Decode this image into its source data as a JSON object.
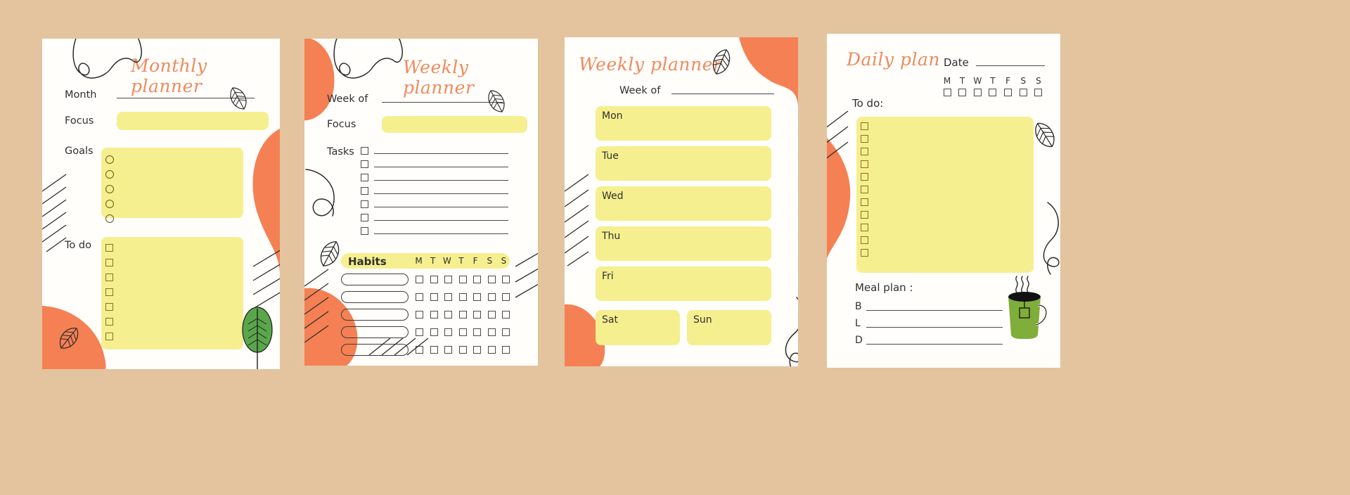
{
  "page": {
    "background_color": "#e3c49e",
    "card_color": "#fffefb",
    "accent_color": "#ef8a5d",
    "highlight_color": "#f5ef8f",
    "ink_color": "#2f2f2f",
    "leaf_color": "#5aa64b",
    "mug_color": "#7fae3a"
  },
  "cards": [
    {
      "id": "monthly-planner",
      "title": "Monthly planner",
      "fields": [
        {
          "label": "Month",
          "type": "rule"
        },
        {
          "label": "Focus",
          "type": "highlight-bar"
        }
      ],
      "goals": {
        "label": "Goals",
        "marker": "circle",
        "rows": 5
      },
      "todo": {
        "label": "To do",
        "marker": "square",
        "rows": 7
      }
    },
    {
      "id": "weekly-planner-tasks",
      "title": "Weekly planner",
      "fields": [
        {
          "label": "Week of",
          "type": "rule"
        },
        {
          "label": "Focus",
          "type": "highlight-bar"
        }
      ],
      "tasks": {
        "label": "Tasks",
        "marker": "square",
        "rows": 7
      },
      "habits": {
        "label": "Habits",
        "days": [
          "M",
          "T",
          "W",
          "T",
          "F",
          "S",
          "S"
        ],
        "rows": 5
      }
    },
    {
      "id": "weekly-planner-days",
      "title": "Weekly planner",
      "fields": [
        {
          "label": "Week of",
          "type": "rule"
        }
      ],
      "days_full": [
        "Mon",
        "Tue",
        "Wed",
        "Thu",
        "Fri"
      ],
      "days_half": [
        "Sat",
        "Sun"
      ]
    },
    {
      "id": "daily-plan",
      "title": "Daily plan",
      "date": {
        "label": "Date",
        "type": "rule"
      },
      "day_selector": {
        "days": [
          "M",
          "T",
          "W",
          "T",
          "F",
          "S",
          "S"
        ]
      },
      "todo": {
        "label": "To do:",
        "marker": "square",
        "rows": 11
      },
      "meal_plan": {
        "label": "Meal plan :",
        "meals": [
          "B",
          "L",
          "D"
        ]
      }
    }
  ]
}
